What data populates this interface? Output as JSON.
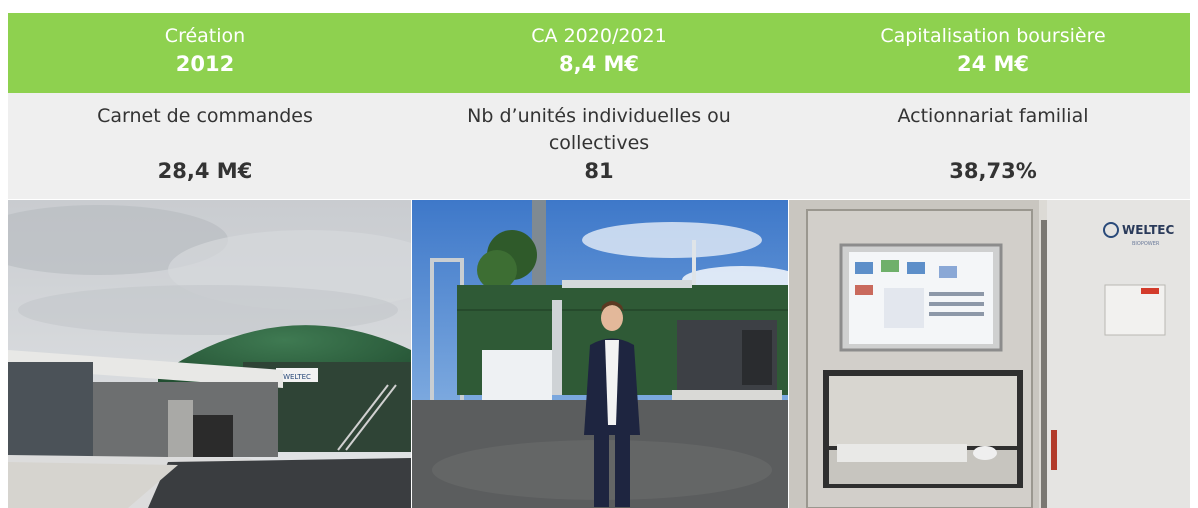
{
  "top_row": [
    {
      "label": "Création",
      "value": "2012"
    },
    {
      "label": "CA 2020/2021",
      "value": "8,4 M€"
    },
    {
      "label": "Capitalisation boursière",
      "value": "24 M€"
    }
  ],
  "bottom_row": [
    {
      "label": "Carnet de commandes",
      "value": "28,4 M€"
    },
    {
      "label": "Nb d’unités individuelles ou collectives",
      "value": "81"
    },
    {
      "label": "Actionnariat familial",
      "value": "38,73%"
    }
  ],
  "photos": {
    "biogas_plant_sign": "WELTEC",
    "control_cabinet_logo": "WELTEC",
    "control_cabinet_logo_sub": "BIOPOWER"
  },
  "colors": {
    "green_band": "#8ed14f",
    "grey_band": "#efefef"
  }
}
